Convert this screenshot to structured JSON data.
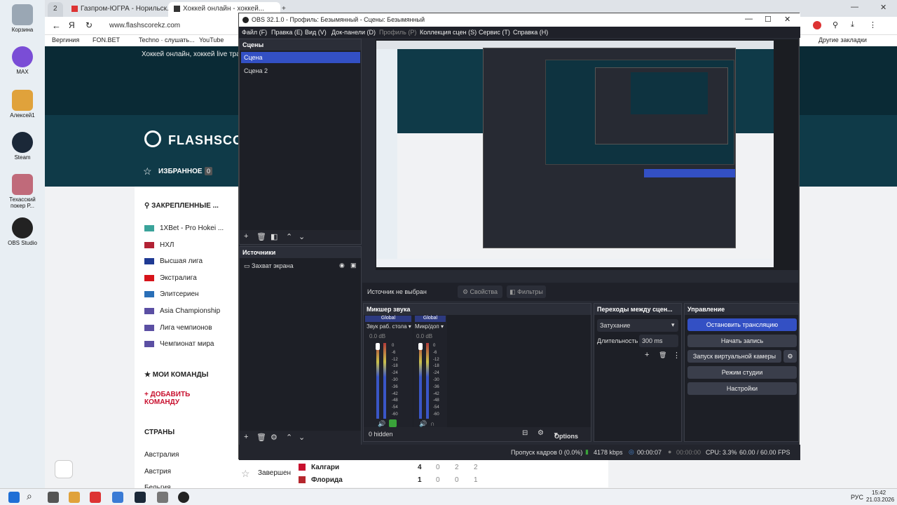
{
  "desktop": {
    "icons": [
      {
        "label": "Корзина",
        "icon": "recycle-bin-icon",
        "color": "#9aa7b4"
      },
      {
        "label": "MAX",
        "icon": "max-icon",
        "color": "#7a4dd6"
      },
      {
        "label": "Алексей1",
        "icon": "folder-icon",
        "color": "#e0a23b"
      },
      {
        "label": "Steam",
        "icon": "steam-icon",
        "color": "#1b2838"
      },
      {
        "label": "Техасский покер Р...",
        "icon": "poker-icon",
        "color": "#c06a7a"
      },
      {
        "label": "OBS Studio",
        "icon": "obs-icon",
        "color": "#222222"
      }
    ]
  },
  "browser": {
    "tab_counter": "2",
    "tabs": [
      {
        "title": "Газпром-ЮГРА - Норильск..."
      },
      {
        "title": "Хоккей онлайн - хоккей..."
      }
    ],
    "new_tab": "+",
    "url": "www.flashscorekz.com",
    "bookmarks": [
      "Вергиния",
      "FON.BET",
      "Techno · слушать...",
      "YouTube"
    ],
    "other_bookmarks": "Другие закладки",
    "site": {
      "banner_text": "Хоккей онлайн, хоккей live трансляции",
      "logo_text": "FLASHSCORE",
      "favorites_label": "ИЗБРАННОЕ",
      "favorites_count": "0",
      "pinned_header": "ЗАКРЕПЛЕННЫЕ ...",
      "pinned": [
        {
          "label": "1XBet - Pro Hokei ...",
          "color": "#3aa39a"
        },
        {
          "label": "НХЛ",
          "color": "#b22234"
        },
        {
          "label": "Высшая лига",
          "color": "#1f3a93"
        },
        {
          "label": "Экстралига",
          "color": "#d7141a"
        },
        {
          "label": "Элитсериен",
          "color": "#2a6fb7"
        },
        {
          "label": "Asia Championship",
          "color": "#5b4fa3"
        },
        {
          "label": "Лига чемпионов",
          "color": "#5b4fa3"
        },
        {
          "label": "Чемпионат мира",
          "color": "#5b4fa3"
        }
      ],
      "my_teams_header": "МОИ КОМАНДЫ",
      "add_team": "ДОБАВИТЬ КОМАНДУ",
      "countries_header": "СТРАНЫ",
      "countries": [
        "Австралия",
        "Австрия",
        "Бельгия"
      ],
      "match": {
        "status": "Завершен",
        "home": {
          "team": "Калгари",
          "score": "4",
          "periods": [
            "0",
            "2",
            "2"
          ]
        },
        "away": {
          "team": "Флорида",
          "score": "1",
          "periods": [
            "0",
            "0",
            "1"
          ]
        }
      }
    }
  },
  "obs": {
    "title": "OBS 32.1.0 - Профиль: Безымянный - Сцены: Безымянный",
    "menu": [
      "Файл (F)",
      "Правка (E)",
      "Вид (V)",
      "Док-панели (D)",
      "Профиль (P)",
      "Коллекция сцен (S)",
      "Сервис (T)",
      "Справка (H)"
    ],
    "scenes": {
      "header": "Сцены",
      "items": [
        "Сцена",
        "Сцена 2"
      ]
    },
    "sources": {
      "header": "Источники",
      "items": [
        "Захват экрана"
      ]
    },
    "source_bar": {
      "label": "Источник не выбран",
      "properties": "Свойства",
      "filters": "Фильтры"
    },
    "mixer": {
      "header": "Микшер звука",
      "channels": [
        {
          "tag": "Global",
          "name": "Звук раб. стола",
          "db": "0.0 dB"
        },
        {
          "tag": "Global",
          "name": "Микр/доп",
          "db": "0.0 dB"
        }
      ],
      "scale": [
        "0",
        "-6",
        "-12",
        "-18",
        "-24",
        "-30",
        "-36",
        "-42",
        "-48",
        "-54",
        "-60"
      ],
      "hidden": "0 hidden",
      "options": "Options"
    },
    "transitions": {
      "header": "Переходы между сцен...",
      "type": "Затухание",
      "duration_label": "Длительность",
      "duration_value": "300 ms"
    },
    "controls": {
      "header": "Управление",
      "stop_stream": "Остановить трансляцию",
      "start_record": "Начать запись",
      "virtual_cam": "Запуск виртуальной камеры",
      "studio_mode": "Режим студии",
      "settings": "Настройки"
    },
    "status": {
      "dropped": "Пропуск кадров 0 (0.0%)",
      "bitrate": "4178 kbps",
      "stream_time": "00:00:07",
      "rec_time": "00:00:00",
      "cpu": "CPU: 3.3%",
      "fps": "60.00 / 60.00 FPS"
    }
  },
  "taskbar": {
    "lang": "РУС",
    "time": "15:42",
    "date": "21.03.2026"
  }
}
